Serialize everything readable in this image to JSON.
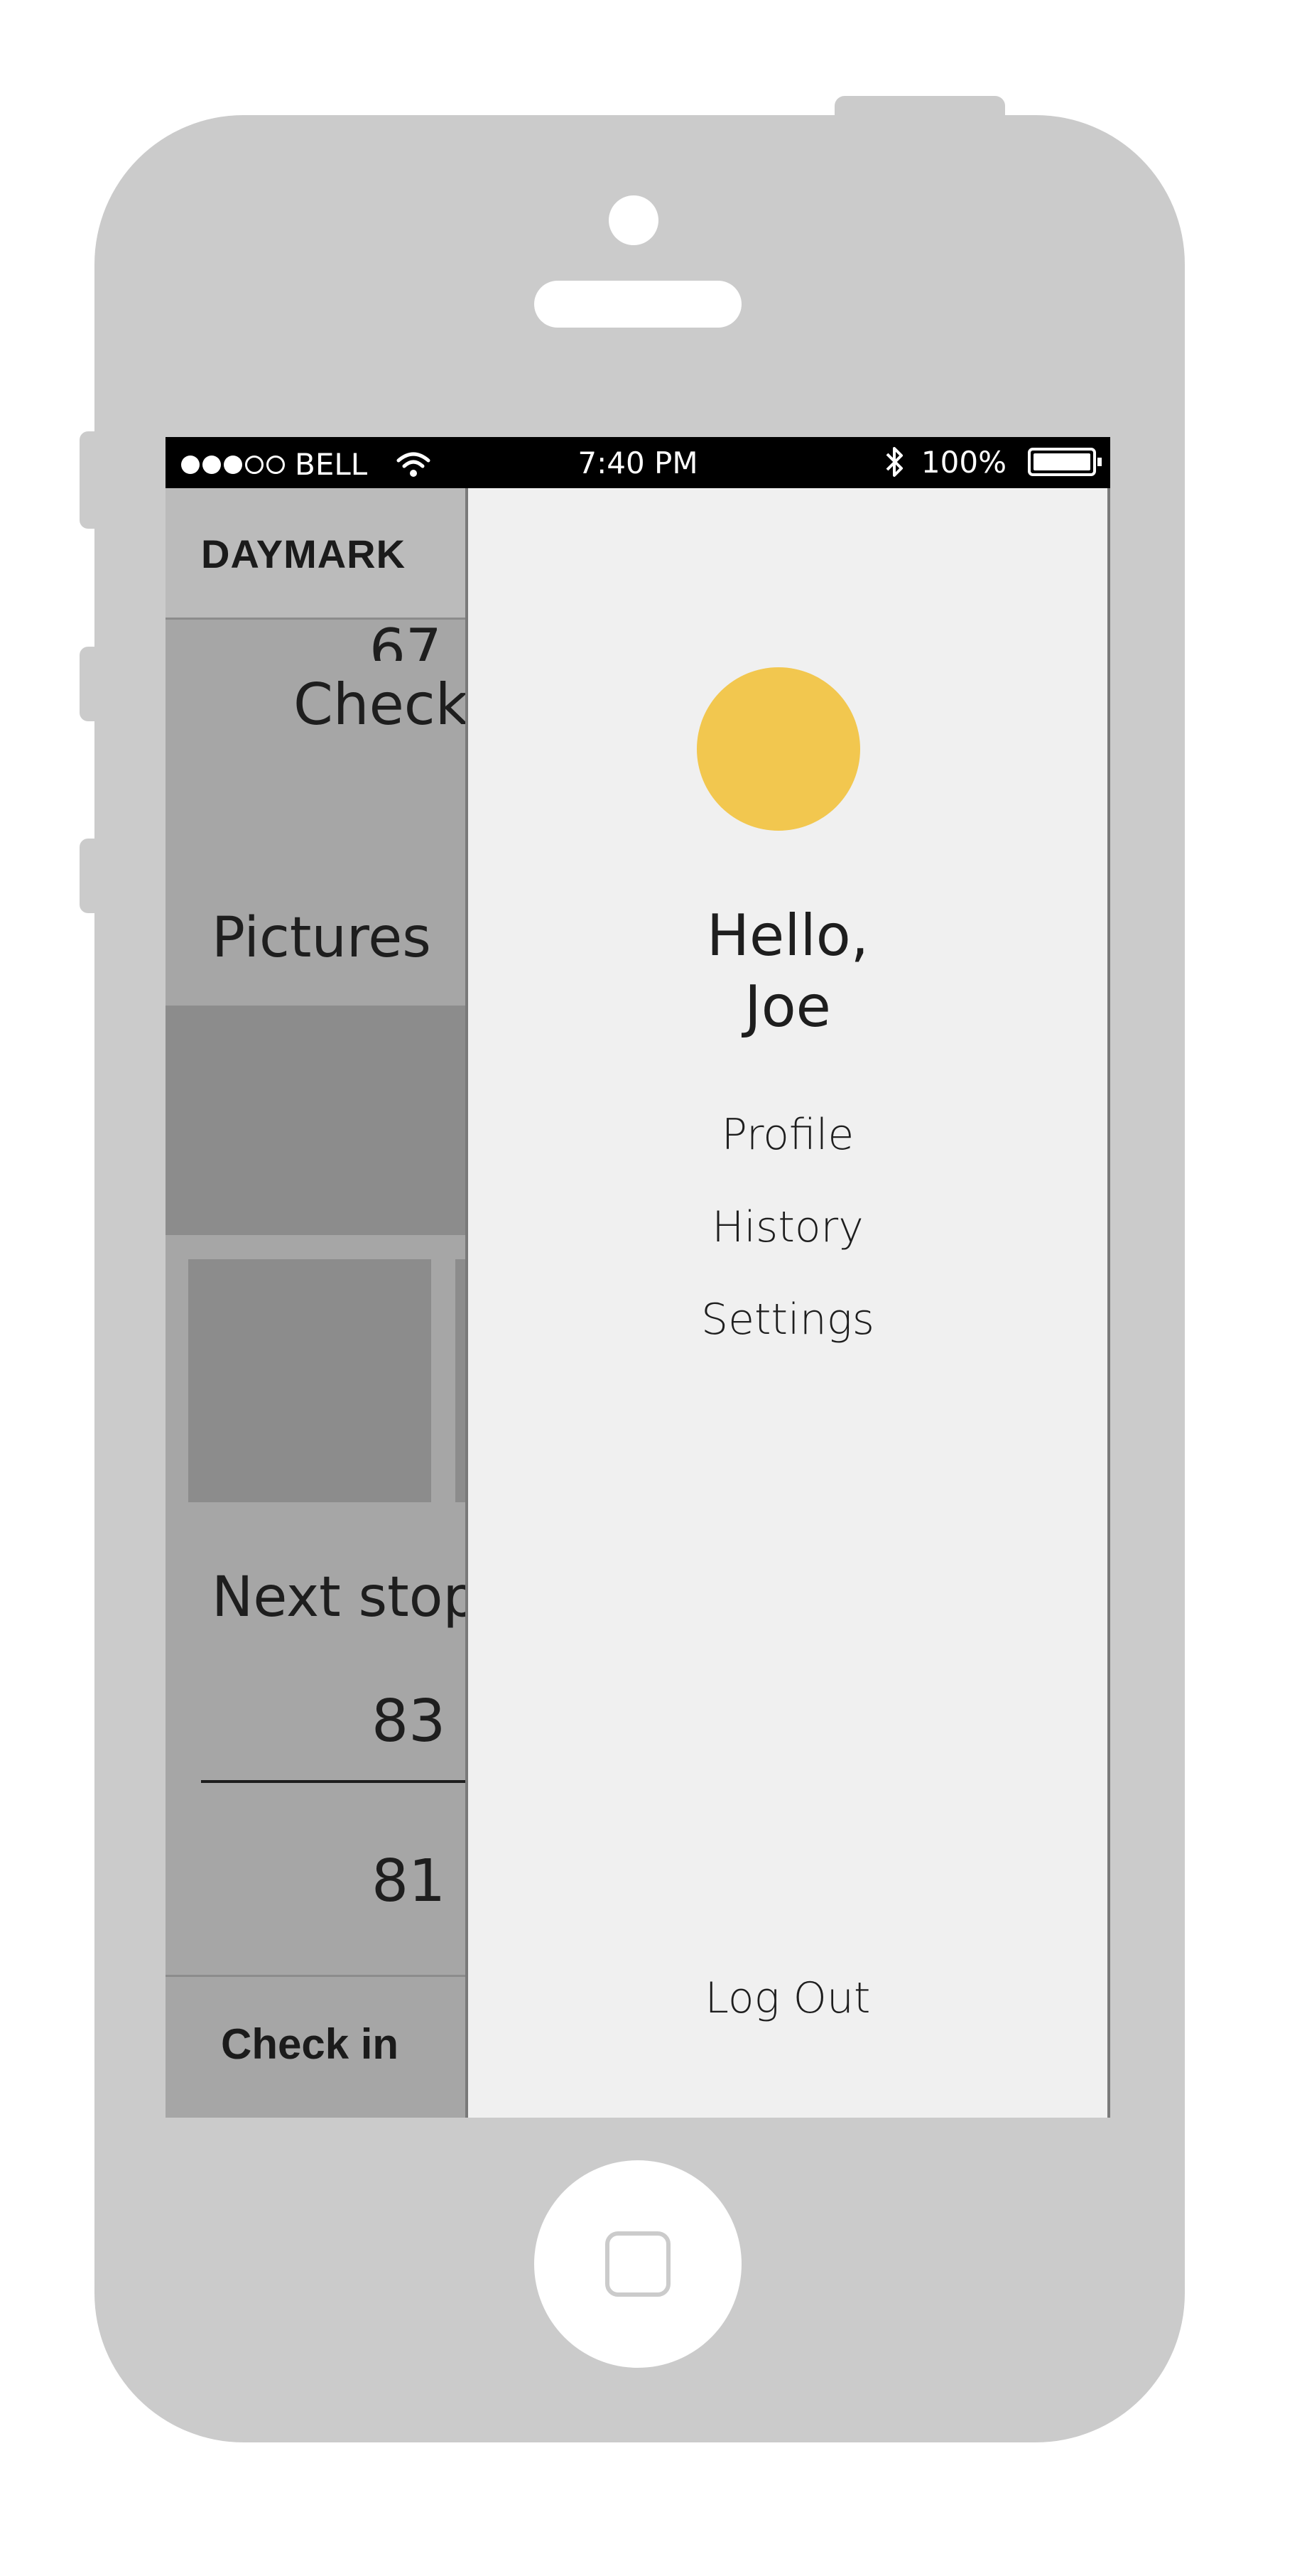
{
  "status_bar": {
    "carrier": "BELL",
    "time": "7:40 PM",
    "battery": "100%",
    "icons": [
      "signal-dots-icon",
      "wifi-icon",
      "bluetooth-icon",
      "battery-icon"
    ]
  },
  "app": {
    "title": "DAYMARK",
    "checkins_count": "67",
    "checkins_label": "Check",
    "pictures_label": "Pictures",
    "next_stop_label": "Next stop",
    "stops": [
      "83 (",
      "81 ("
    ],
    "checkin_button": "Check in"
  },
  "drawer": {
    "greeting_line1": "Hello,",
    "greeting_line2": "Joe",
    "avatar_color": "#f2c74f",
    "menu": [
      "Profile",
      "History",
      "Settings"
    ],
    "logout": "Log Out"
  }
}
